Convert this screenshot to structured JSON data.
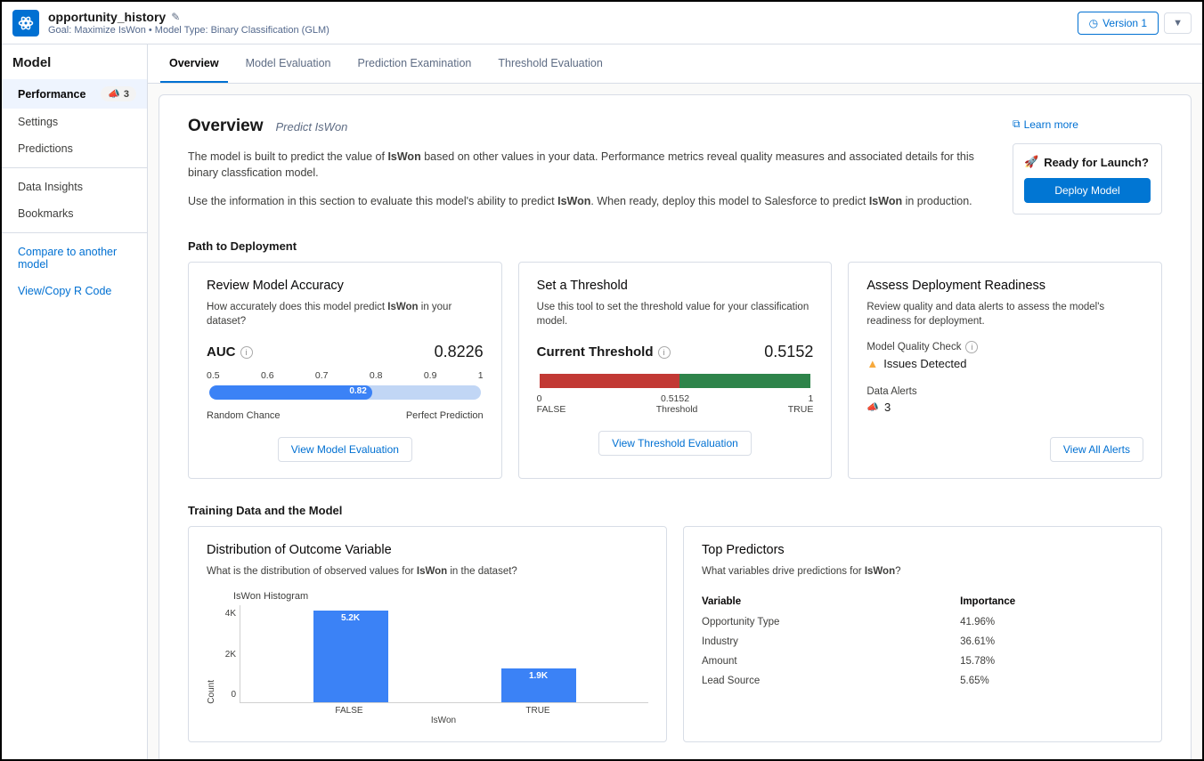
{
  "header": {
    "title": "opportunity_history",
    "subtitle": "Goal: Maximize IsWon • Model Type: Binary Classification (GLM)",
    "version_label": "Version 1"
  },
  "sidebar": {
    "title": "Model",
    "items": [
      {
        "label": "Performance",
        "badge": "3"
      },
      {
        "label": "Settings"
      },
      {
        "label": "Predictions"
      }
    ],
    "items2": [
      {
        "label": "Data Insights"
      },
      {
        "label": "Bookmarks"
      }
    ],
    "links": [
      {
        "label": "Compare to another model"
      },
      {
        "label": "View/Copy R Code"
      }
    ]
  },
  "tabs": [
    "Overview",
    "Model Evaluation",
    "Prediction Examination",
    "Threshold Evaluation"
  ],
  "overview": {
    "title": "Overview",
    "subtitle": "Predict IsWon",
    "learn_more": "Learn more",
    "desc1a": "The model is built to predict the value of ",
    "desc1b": "IsWon",
    "desc1c": " based on other values in your data. Performance metrics reveal quality measures and associated details for this binary classfication model.",
    "desc2a": "Use the information in this section to evaluate this model's ability to predict ",
    "desc2b": "IsWon",
    "desc2c": ". When ready, deploy this model to Salesforce to predict ",
    "desc2d": "IsWon",
    "desc2e": " in production.",
    "launch_title": "Ready for Launch?",
    "deploy_label": "Deploy Model"
  },
  "path": {
    "title": "Path to Deployment",
    "card1": {
      "title": "Review Model Accuracy",
      "sub_a": "How accurately does this model predict ",
      "sub_b": "IsWon",
      "sub_c": " in your dataset?",
      "metric_label": "AUC",
      "metric_val": "0.8226",
      "ticks": [
        "0.5",
        "0.6",
        "0.7",
        "0.8",
        "0.9",
        "1"
      ],
      "fill_label": "0.82",
      "foot_left": "Random Chance",
      "foot_right": "Perfect Prediction",
      "btn": "View Model Evaluation"
    },
    "card2": {
      "title": "Set a Threshold",
      "sub": "Use this tool to set the threshold value for your classification model.",
      "metric_label": "Current Threshold",
      "metric_val": "0.5152",
      "t_left": "0",
      "t_mid": "0.5152",
      "t_right": "1",
      "t2_left": "FALSE",
      "t2_mid": "Threshold",
      "t2_right": "TRUE",
      "btn": "View Threshold Evaluation"
    },
    "card3": {
      "title": "Assess Deployment Readiness",
      "sub": "Review quality and data alerts to assess the model's readiness for deployment.",
      "mq_label": "Model Quality Check",
      "issues": "Issues Detected",
      "da_label": "Data Alerts",
      "da_count": "3",
      "btn": "View All Alerts"
    }
  },
  "training": {
    "title": "Training Data and the Model",
    "card1": {
      "title": "Distribution of Outcome Variable",
      "sub_a": "What is the distribution of observed values for ",
      "sub_b": "IsWon",
      "sub_c": " in the dataset?",
      "hist_title": "IsWon Histogram",
      "ylabel": "Count",
      "yticks": [
        "4K",
        "2K",
        "0"
      ],
      "bar1_label": "5.2K",
      "bar2_label": "1.9K",
      "xtick1": "FALSE",
      "xtick2": "TRUE",
      "xlabel": "IsWon"
    },
    "card2": {
      "title": "Top Predictors",
      "sub_a": "What variables drive predictions for ",
      "sub_b": "IsWon",
      "sub_c": "?",
      "col1": "Variable",
      "col2": "Importance",
      "rows": [
        {
          "v": "Opportunity Type",
          "i": "41.96%"
        },
        {
          "v": "Industry",
          "i": "36.61%"
        },
        {
          "v": "Amount",
          "i": "15.78%"
        },
        {
          "v": "Lead Source",
          "i": "5.65%"
        }
      ]
    }
  },
  "chart_data": {
    "type": "bar",
    "categories": [
      "FALSE",
      "TRUE"
    ],
    "values": [
      5200,
      1900
    ],
    "title": "IsWon Histogram",
    "xlabel": "IsWon",
    "ylabel": "Count",
    "ylim": [
      0,
      5500
    ]
  }
}
